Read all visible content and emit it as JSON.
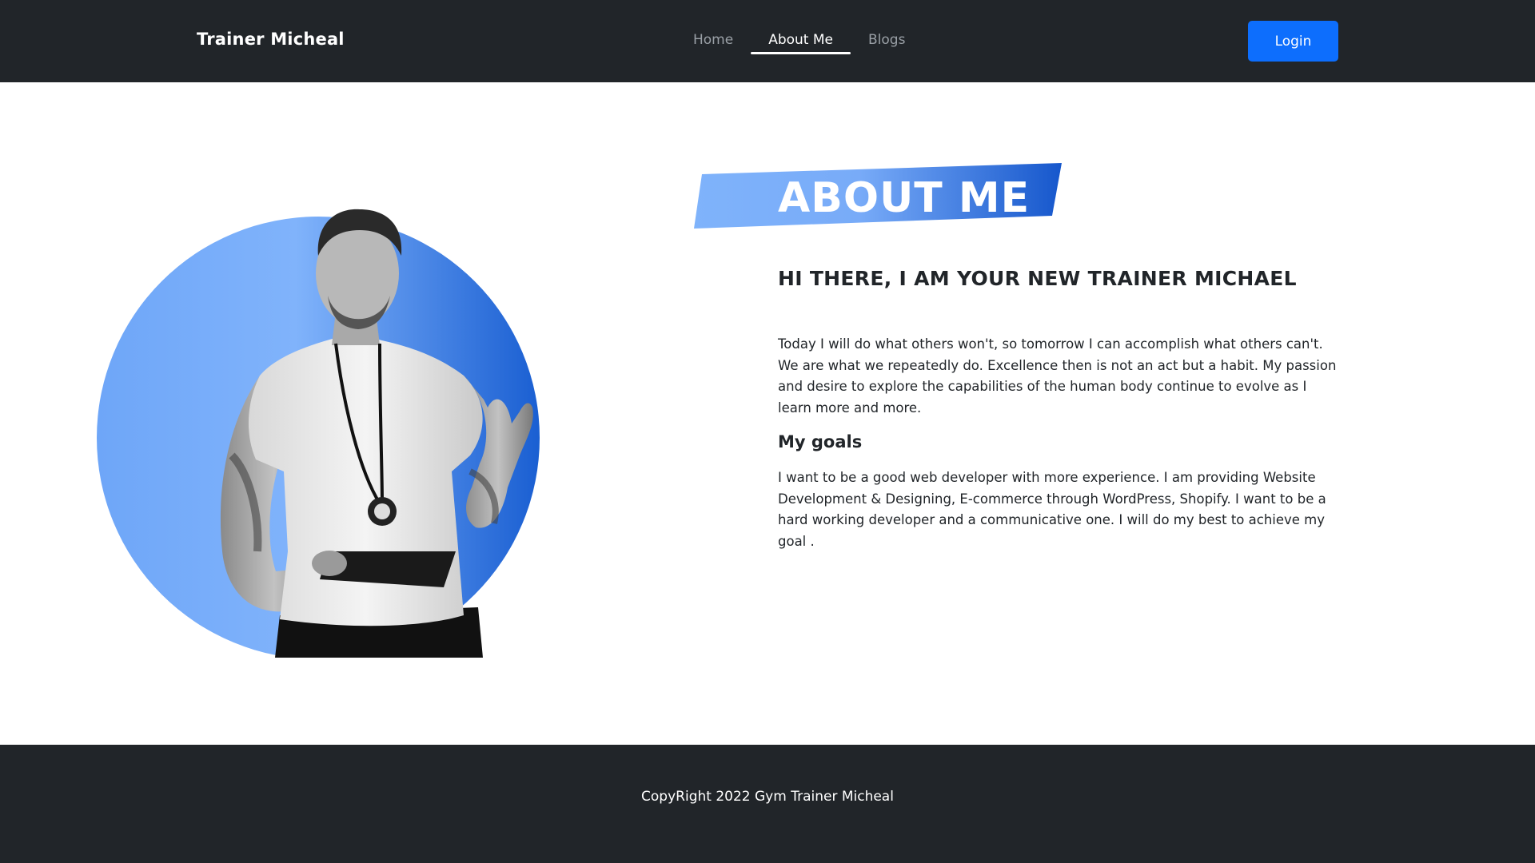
{
  "navbar": {
    "brand": "Trainer Micheal",
    "links": [
      {
        "label": "Home",
        "active": false
      },
      {
        "label": "About Me",
        "active": true
      },
      {
        "label": "Blogs",
        "active": false
      }
    ],
    "login_label": "Login"
  },
  "about": {
    "title": "ABOUT ME",
    "greeting": "HI THERE, I AM YOUR NEW TRAINER MICHAEL",
    "intro": "Today I will do what others won't, so tomorrow I can accomplish what others can't. We are what we repeatedly do. Excellence then is not an act but a habit. My passion and desire to explore the capabilities of the human body continue to evolve as I learn more and more.",
    "goals_heading": "My goals",
    "goals": "I want to be a good web developer with more experience. I am providing Website Development & Designing, E-commerce through WordPress, Shopify. I want to be a hard working developer and a communicative one. I will do my best to achieve my goal ."
  },
  "footer": {
    "copyright": "CopyRight 2022 Gym Trainer Micheal"
  },
  "colors": {
    "nav_bg": "#212529",
    "primary": "#0d6efd",
    "accent_light": "#7eb2fb",
    "accent_dark": "#1b5ed1"
  },
  "icons": {
    "hero": "trainer-portrait-image"
  }
}
